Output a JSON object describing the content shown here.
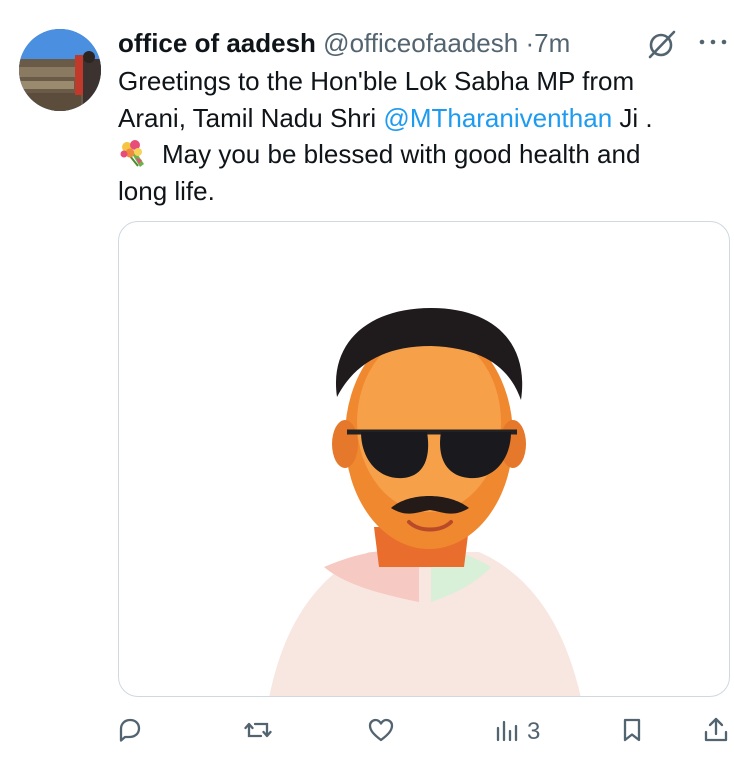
{
  "tweet": {
    "author_name": "office of aadesh",
    "author_handle": "@officeofaadesh",
    "separator": "·",
    "time": "7m",
    "text_line1": "Greetings to the Hon'ble Lok Sabha MP from",
    "text_line2_prefix": "Arani, Tamil Nadu Shri ",
    "mention": "@MTharaniventhan",
    "text_line2_suffix": " Ji .",
    "text_line3": "May you be blessed with good health and",
    "text_line4": "long life.",
    "emoji_icon": "bouquet-icon",
    "media_icon": "portrait-image"
  },
  "actions": {
    "reply_icon": "reply-icon",
    "repost_icon": "repost-icon",
    "like_icon": "like-icon",
    "views_icon": "views-icon",
    "views_count": "3",
    "bookmark_icon": "bookmark-icon",
    "share_icon": "share-icon"
  },
  "colors": {
    "text": "#0f1419",
    "secondary": "#536471",
    "link": "#1d9bf0",
    "border": "#cfd9de"
  }
}
